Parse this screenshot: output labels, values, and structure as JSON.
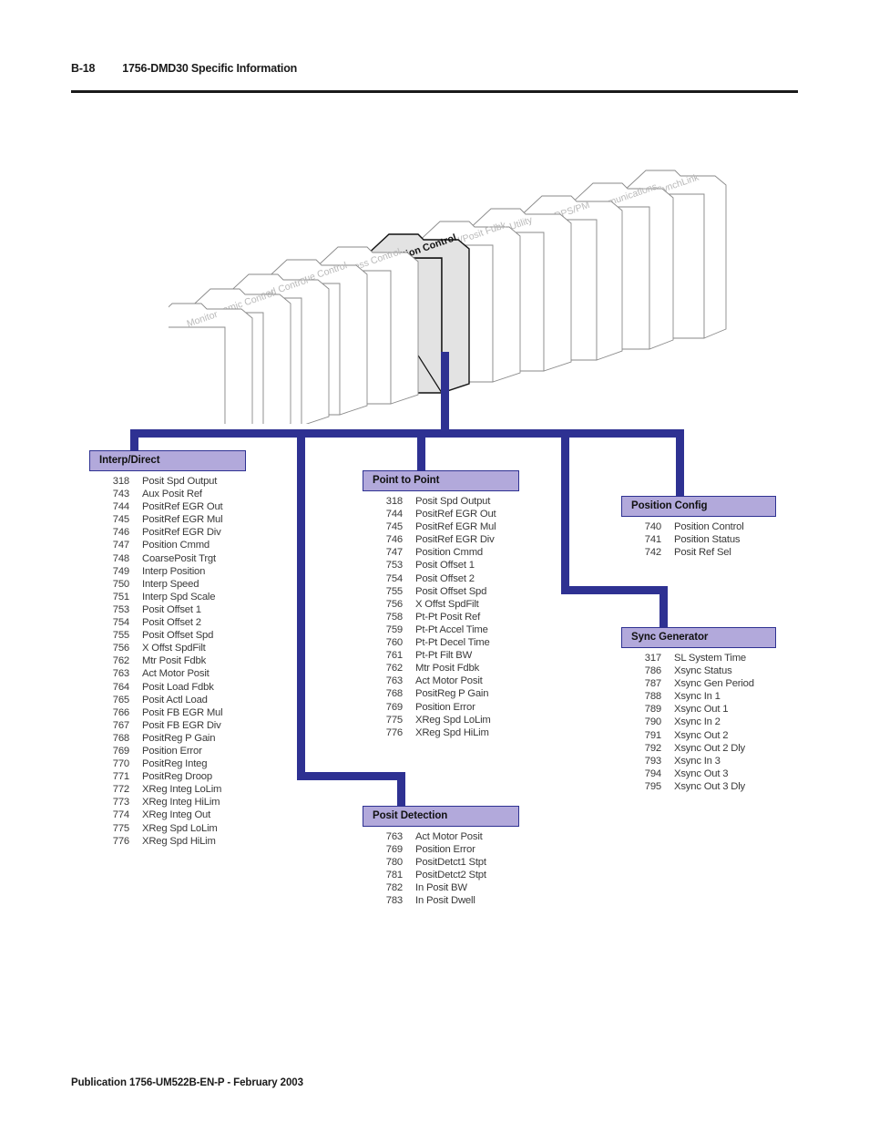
{
  "header": {
    "folio": "B-18",
    "title": "1756-DMD30 Specific Information"
  },
  "footer": {
    "text": "Publication 1756-UM522B-EN-P - February 2003"
  },
  "colors": {
    "connector": "#2e3192",
    "box_header_fill": "#b2a9db",
    "box_header_border": "#2e3192",
    "highlight_folder_fill": "#e3e3e3",
    "text": "#1a1a1a"
  },
  "folder_stack": {
    "selected": "Position Control",
    "tabs": [
      {
        "label": "Monitor",
        "selected": false
      },
      {
        "label": "Dynamic Control",
        "selected": false
      },
      {
        "label": "Speed Control",
        "selected": false
      },
      {
        "label": "Torque Control",
        "selected": false
      },
      {
        "label": "Process Control",
        "selected": false
      },
      {
        "label": "Position Control",
        "selected": true
      },
      {
        "label": "Speed/Posit Fdbk",
        "selected": false
      },
      {
        "label": "Utility",
        "selected": false
      },
      {
        "label": "DPS/PM",
        "selected": false
      },
      {
        "label": "Communications",
        "selected": false
      },
      {
        "label": "SynchLink",
        "selected": false
      }
    ]
  },
  "boxes": {
    "interp_direct": {
      "title": "Interp/Direct",
      "params": [
        {
          "num": "318",
          "name": "Posit Spd Output"
        },
        {
          "num": "743",
          "name": "Aux Posit Ref"
        },
        {
          "num": "744",
          "name": "PositRef EGR Out"
        },
        {
          "num": "745",
          "name": "PositRef EGR Mul"
        },
        {
          "num": "746",
          "name": "PositRef EGR Div"
        },
        {
          "num": "747",
          "name": "Position Cmmd"
        },
        {
          "num": "748",
          "name": "CoarsePosit Trgt"
        },
        {
          "num": "749",
          "name": "Interp Position"
        },
        {
          "num": "750",
          "name": "Interp Speed"
        },
        {
          "num": "751",
          "name": "Interp Spd Scale"
        },
        {
          "num": "753",
          "name": "Posit Offset 1"
        },
        {
          "num": "754",
          "name": "Posit Offset 2"
        },
        {
          "num": "755",
          "name": "Posit Offset Spd"
        },
        {
          "num": "756",
          "name": "X Offst SpdFilt"
        },
        {
          "num": "762",
          "name": "Mtr Posit Fdbk"
        },
        {
          "num": "763",
          "name": "Act Motor Posit"
        },
        {
          "num": "764",
          "name": "Posit Load Fdbk"
        },
        {
          "num": "765",
          "name": "Posit Actl Load"
        },
        {
          "num": "766",
          "name": "Posit FB EGR Mul"
        },
        {
          "num": "767",
          "name": "Posit FB EGR Div"
        },
        {
          "num": "768",
          "name": "PositReg P Gain"
        },
        {
          "num": "769",
          "name": "Position Error"
        },
        {
          "num": "770",
          "name": "PositReg Integ"
        },
        {
          "num": "771",
          "name": "PositReg Droop"
        },
        {
          "num": "772",
          "name": "XReg Integ LoLim"
        },
        {
          "num": "773",
          "name": "XReg Integ HiLim"
        },
        {
          "num": "774",
          "name": "XReg Integ Out"
        },
        {
          "num": "775",
          "name": "XReg Spd LoLim"
        },
        {
          "num": "776",
          "name": "XReg Spd HiLim"
        }
      ]
    },
    "point_to_point": {
      "title": "Point to Point",
      "params": [
        {
          "num": "318",
          "name": "Posit Spd Output"
        },
        {
          "num": "744",
          "name": "PositRef EGR Out"
        },
        {
          "num": "745",
          "name": "PositRef EGR Mul"
        },
        {
          "num": "746",
          "name": "PositRef EGR Div"
        },
        {
          "num": "747",
          "name": "Position Cmmd"
        },
        {
          "num": "753",
          "name": "Posit Offset 1"
        },
        {
          "num": "754",
          "name": "Posit Offset 2"
        },
        {
          "num": "755",
          "name": "Posit Offset Spd"
        },
        {
          "num": "756",
          "name": "X Offst SpdFilt"
        },
        {
          "num": "758",
          "name": "Pt-Pt Posit Ref"
        },
        {
          "num": "759",
          "name": "Pt-Pt Accel Time"
        },
        {
          "num": "760",
          "name": "Pt-Pt Decel Time"
        },
        {
          "num": "761",
          "name": "Pt-Pt Filt BW"
        },
        {
          "num": "762",
          "name": "Mtr Posit Fdbk"
        },
        {
          "num": "763",
          "name": "Act Motor Posit"
        },
        {
          "num": "768",
          "name": "PositReg P Gain"
        },
        {
          "num": "769",
          "name": "Position Error"
        },
        {
          "num": "775",
          "name": "XReg Spd LoLim"
        },
        {
          "num": "776",
          "name": "XReg Spd HiLim"
        }
      ]
    },
    "posit_detection": {
      "title": "Posit Detection",
      "params": [
        {
          "num": "763",
          "name": "Act Motor Posit"
        },
        {
          "num": "769",
          "name": "Position Error"
        },
        {
          "num": "780",
          "name": "PositDetct1 Stpt"
        },
        {
          "num": "781",
          "name": "PositDetct2 Stpt"
        },
        {
          "num": "782",
          "name": "In Posit BW"
        },
        {
          "num": "783",
          "name": "In Posit Dwell"
        }
      ]
    },
    "position_config": {
      "title": "Position Config",
      "params": [
        {
          "num": "740",
          "name": "Position Control"
        },
        {
          "num": "741",
          "name": "Position Status"
        },
        {
          "num": "742",
          "name": "Posit Ref Sel"
        }
      ]
    },
    "sync_generator": {
      "title": "Sync Generator",
      "params": [
        {
          "num": "317",
          "name": "SL System Time"
        },
        {
          "num": "786",
          "name": "Xsync Status"
        },
        {
          "num": "787",
          "name": "Xsync Gen Period"
        },
        {
          "num": "788",
          "name": "Xsync In 1"
        },
        {
          "num": "789",
          "name": "Xsync Out 1"
        },
        {
          "num": "790",
          "name": "Xsync In 2"
        },
        {
          "num": "791",
          "name": "Xsync Out 2"
        },
        {
          "num": "792",
          "name": "Xsync Out 2 Dly"
        },
        {
          "num": "793",
          "name": "Xsync In 3"
        },
        {
          "num": "794",
          "name": "Xsync Out 3"
        },
        {
          "num": "795",
          "name": "Xsync Out 3 Dly"
        }
      ]
    }
  }
}
